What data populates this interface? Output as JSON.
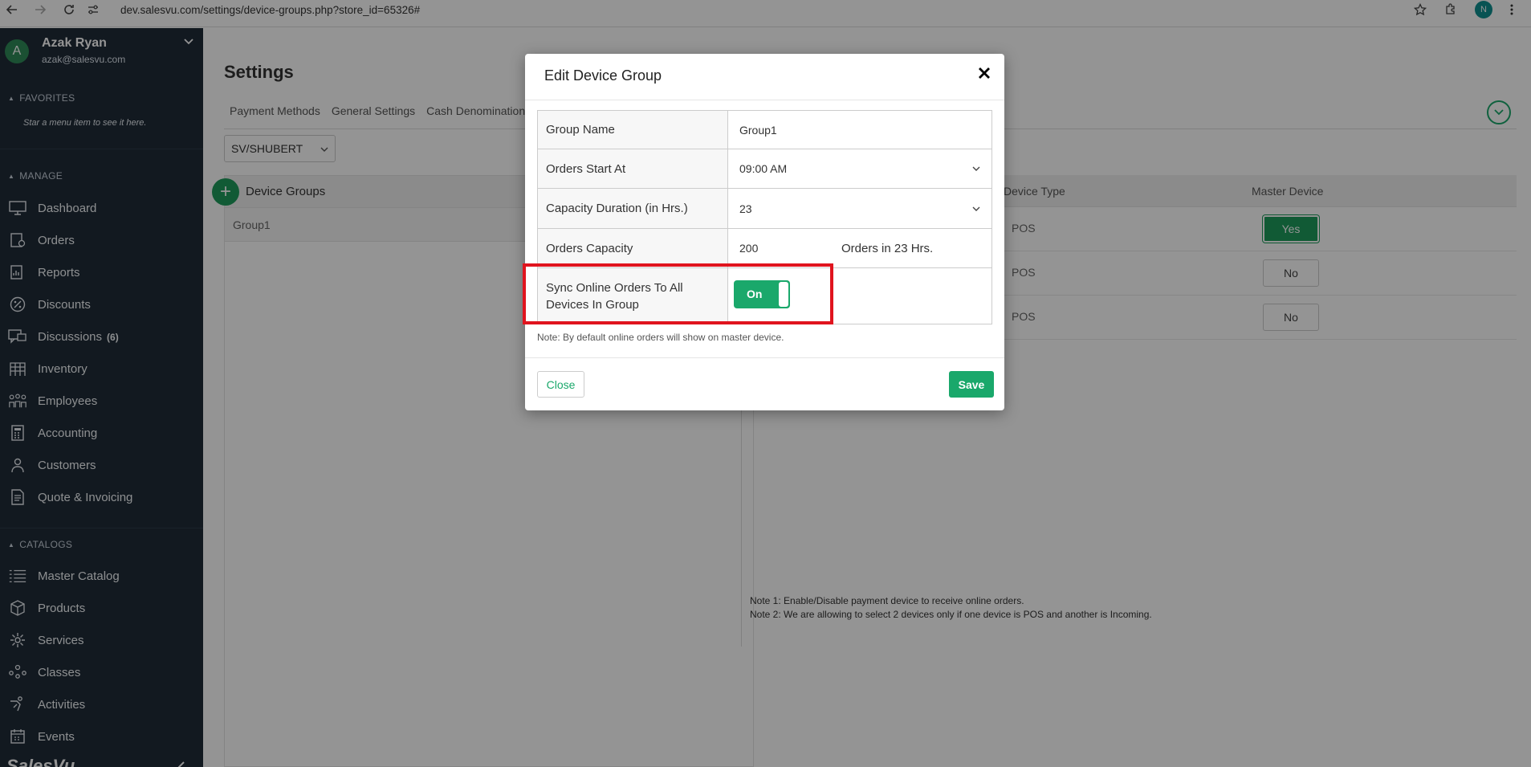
{
  "browser": {
    "url": "dev.salesvu.com/settings/device-groups.php?store_id=65326#",
    "profile_initial": "N"
  },
  "sidebar": {
    "user": {
      "initial": "A",
      "name": "Azak Ryan",
      "email": "azak@salesvu.com"
    },
    "favorites_header": "FAVORITES",
    "favorites_hint": "Star a menu item to see it here.",
    "manage_header": "MANAGE",
    "manage_items": [
      {
        "label": "Dashboard",
        "icon": "monitor-icon"
      },
      {
        "label": "Orders",
        "icon": "orders-icon"
      },
      {
        "label": "Reports",
        "icon": "reports-icon"
      },
      {
        "label": "Discounts",
        "icon": "percent-icon"
      },
      {
        "label": "Discussions",
        "badge": "(6)",
        "icon": "discussions-icon"
      },
      {
        "label": "Inventory",
        "icon": "inventory-icon"
      },
      {
        "label": "Employees",
        "icon": "employees-icon"
      },
      {
        "label": "Accounting",
        "icon": "calculator-icon"
      },
      {
        "label": "Customers",
        "icon": "customer-icon"
      },
      {
        "label": "Quote & Invoicing",
        "icon": "invoice-icon"
      }
    ],
    "catalogs_header": "CATALOGS",
    "catalog_items": [
      {
        "label": "Master Catalog",
        "icon": "list-icon"
      },
      {
        "label": "Products",
        "icon": "box-icon"
      },
      {
        "label": "Services",
        "icon": "services-icon"
      },
      {
        "label": "Classes",
        "icon": "classes-icon"
      },
      {
        "label": "Activities",
        "icon": "activities-icon"
      },
      {
        "label": "Events",
        "icon": "calendar-icon"
      }
    ],
    "logo_text": "SalesVu"
  },
  "main": {
    "title": "Settings",
    "tabs": [
      "Payment Methods",
      "General Settings",
      "Cash Denominations"
    ],
    "store_select": "SV/SHUBERT",
    "groups_header": "Device Groups",
    "groups": [
      "Group1"
    ],
    "device_type_header": "Device Type",
    "master_device_header": "Master Device",
    "devices": [
      {
        "type": "POS",
        "master": "Yes"
      },
      {
        "type": "POS",
        "master": "No"
      },
      {
        "type": "POS",
        "master": "No"
      }
    ],
    "note1": "Note 1: Enable/Disable payment device to receive online orders.",
    "note2": "Note 2: We are allowing to select 2 devices only if one device is POS and another is Incoming."
  },
  "modal": {
    "title": "Edit Device Group",
    "fields": {
      "group_name_label": "Group Name",
      "group_name_value": "Group1",
      "orders_start_label": "Orders Start At",
      "orders_start_value": "09:00 AM",
      "capacity_duration_label": "Capacity Duration (in Hrs.)",
      "capacity_duration_value": "23",
      "orders_capacity_label": "Orders Capacity",
      "orders_capacity_value": "200",
      "orders_capacity_suffix": "Orders in 23 Hrs.",
      "sync_label": "Sync Online Orders To All Devices In Group",
      "sync_toggle": "On"
    },
    "note": "Note: By default online orders will show on master device.",
    "close_label": "Close",
    "save_label": "Save"
  },
  "colors": {
    "accent": "#1aa86b",
    "sidebar_bg": "#1f2b38",
    "highlight": "#e0141e"
  }
}
